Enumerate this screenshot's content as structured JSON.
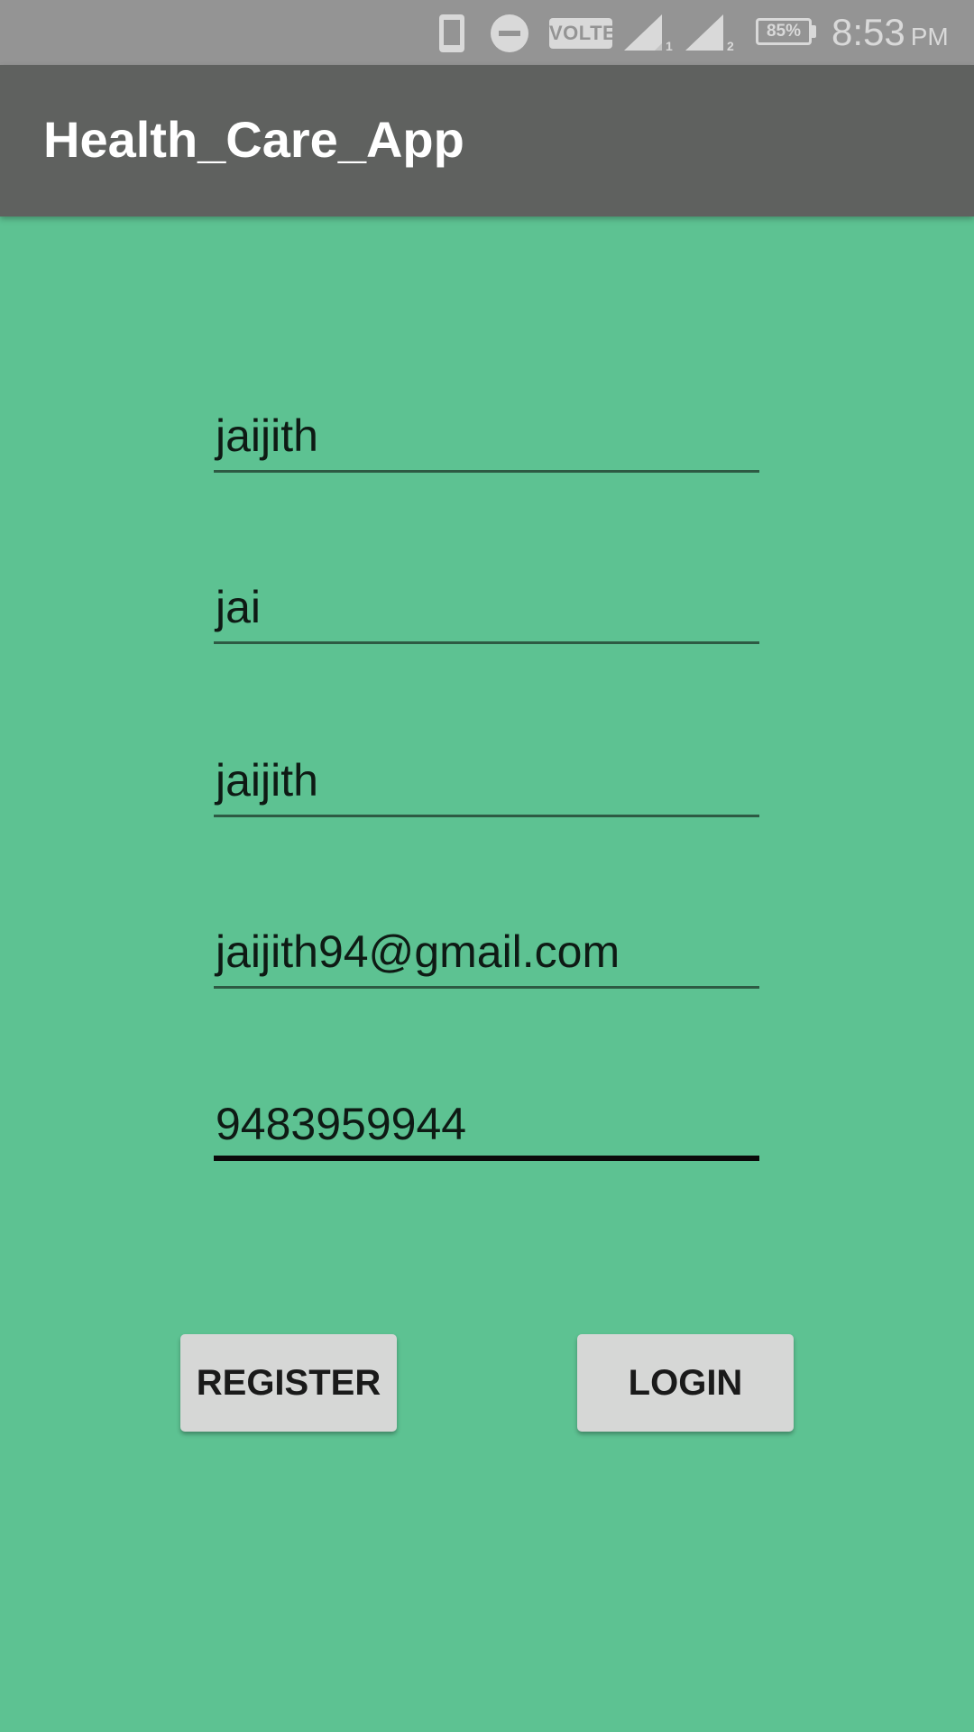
{
  "status_bar": {
    "volte_label": "VOLTE",
    "sim1_label": "1",
    "sim2_label": "2",
    "battery_percent": "85%",
    "time": "8:53",
    "ampm": "PM",
    "icons": [
      "phone-icon",
      "dnd-icon",
      "volte-icon",
      "signal-sim1-icon",
      "signal-sim2-icon",
      "battery-icon"
    ]
  },
  "app_bar": {
    "title": "Health_Care_App"
  },
  "form": {
    "fields": [
      {
        "value": "jaijith",
        "focused": false
      },
      {
        "value": "jai",
        "focused": false
      },
      {
        "value": "jaijith",
        "focused": false
      },
      {
        "value": "jaijith94@gmail.com",
        "focused": false
      },
      {
        "value": "9483959944",
        "focused": true
      }
    ]
  },
  "buttons": {
    "register_label": "REGISTER",
    "login_label": "LOGIN"
  },
  "colors": {
    "background": "#5DC292",
    "app_bar": "#5F615F",
    "status_bar": "#949494",
    "button": "#D6D7D6"
  }
}
